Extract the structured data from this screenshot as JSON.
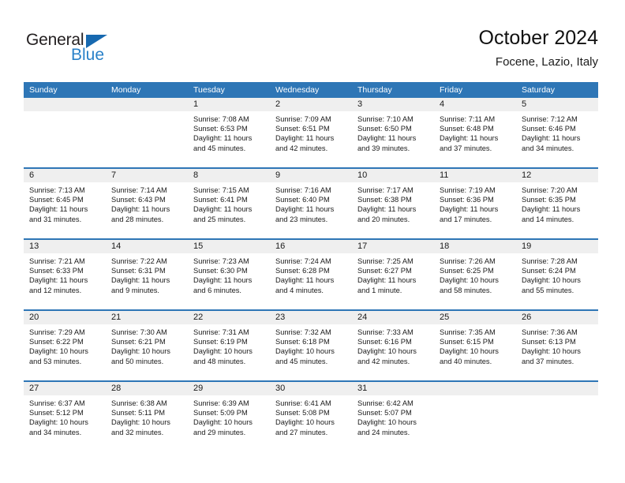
{
  "brand": {
    "name_top": "General",
    "name_bottom": "Blue",
    "color_dark": "#231f20",
    "color_blue": "#2a81c9",
    "triangle_color": "#1769b0"
  },
  "header": {
    "title": "October 2024",
    "subtitle": "Focene, Lazio, Italy"
  },
  "theme": {
    "header_bar": "#2e76b6",
    "day_band": "#efefef",
    "row_divider": "#2e76b6",
    "text": "#1a1a1a"
  },
  "weekdays": [
    "Sunday",
    "Monday",
    "Tuesday",
    "Wednesday",
    "Thursday",
    "Friday",
    "Saturday"
  ],
  "weeks": [
    [
      {
        "day": "",
        "sunrise": "",
        "sunset": "",
        "daylight1": "",
        "daylight2": "",
        "empty": true
      },
      {
        "day": "",
        "sunrise": "",
        "sunset": "",
        "daylight1": "",
        "daylight2": "",
        "empty": true
      },
      {
        "day": "1",
        "sunrise": "Sunrise: 7:08 AM",
        "sunset": "Sunset: 6:53 PM",
        "daylight1": "Daylight: 11 hours",
        "daylight2": "and 45 minutes."
      },
      {
        "day": "2",
        "sunrise": "Sunrise: 7:09 AM",
        "sunset": "Sunset: 6:51 PM",
        "daylight1": "Daylight: 11 hours",
        "daylight2": "and 42 minutes."
      },
      {
        "day": "3",
        "sunrise": "Sunrise: 7:10 AM",
        "sunset": "Sunset: 6:50 PM",
        "daylight1": "Daylight: 11 hours",
        "daylight2": "and 39 minutes."
      },
      {
        "day": "4",
        "sunrise": "Sunrise: 7:11 AM",
        "sunset": "Sunset: 6:48 PM",
        "daylight1": "Daylight: 11 hours",
        "daylight2": "and 37 minutes."
      },
      {
        "day": "5",
        "sunrise": "Sunrise: 7:12 AM",
        "sunset": "Sunset: 6:46 PM",
        "daylight1": "Daylight: 11 hours",
        "daylight2": "and 34 minutes."
      }
    ],
    [
      {
        "day": "6",
        "sunrise": "Sunrise: 7:13 AM",
        "sunset": "Sunset: 6:45 PM",
        "daylight1": "Daylight: 11 hours",
        "daylight2": "and 31 minutes."
      },
      {
        "day": "7",
        "sunrise": "Sunrise: 7:14 AM",
        "sunset": "Sunset: 6:43 PM",
        "daylight1": "Daylight: 11 hours",
        "daylight2": "and 28 minutes."
      },
      {
        "day": "8",
        "sunrise": "Sunrise: 7:15 AM",
        "sunset": "Sunset: 6:41 PM",
        "daylight1": "Daylight: 11 hours",
        "daylight2": "and 25 minutes."
      },
      {
        "day": "9",
        "sunrise": "Sunrise: 7:16 AM",
        "sunset": "Sunset: 6:40 PM",
        "daylight1": "Daylight: 11 hours",
        "daylight2": "and 23 minutes."
      },
      {
        "day": "10",
        "sunrise": "Sunrise: 7:17 AM",
        "sunset": "Sunset: 6:38 PM",
        "daylight1": "Daylight: 11 hours",
        "daylight2": "and 20 minutes."
      },
      {
        "day": "11",
        "sunrise": "Sunrise: 7:19 AM",
        "sunset": "Sunset: 6:36 PM",
        "daylight1": "Daylight: 11 hours",
        "daylight2": "and 17 minutes."
      },
      {
        "day": "12",
        "sunrise": "Sunrise: 7:20 AM",
        "sunset": "Sunset: 6:35 PM",
        "daylight1": "Daylight: 11 hours",
        "daylight2": "and 14 minutes."
      }
    ],
    [
      {
        "day": "13",
        "sunrise": "Sunrise: 7:21 AM",
        "sunset": "Sunset: 6:33 PM",
        "daylight1": "Daylight: 11 hours",
        "daylight2": "and 12 minutes."
      },
      {
        "day": "14",
        "sunrise": "Sunrise: 7:22 AM",
        "sunset": "Sunset: 6:31 PM",
        "daylight1": "Daylight: 11 hours",
        "daylight2": "and 9 minutes."
      },
      {
        "day": "15",
        "sunrise": "Sunrise: 7:23 AM",
        "sunset": "Sunset: 6:30 PM",
        "daylight1": "Daylight: 11 hours",
        "daylight2": "and 6 minutes."
      },
      {
        "day": "16",
        "sunrise": "Sunrise: 7:24 AM",
        "sunset": "Sunset: 6:28 PM",
        "daylight1": "Daylight: 11 hours",
        "daylight2": "and 4 minutes."
      },
      {
        "day": "17",
        "sunrise": "Sunrise: 7:25 AM",
        "sunset": "Sunset: 6:27 PM",
        "daylight1": "Daylight: 11 hours",
        "daylight2": "and 1 minute."
      },
      {
        "day": "18",
        "sunrise": "Sunrise: 7:26 AM",
        "sunset": "Sunset: 6:25 PM",
        "daylight1": "Daylight: 10 hours",
        "daylight2": "and 58 minutes."
      },
      {
        "day": "19",
        "sunrise": "Sunrise: 7:28 AM",
        "sunset": "Sunset: 6:24 PM",
        "daylight1": "Daylight: 10 hours",
        "daylight2": "and 55 minutes."
      }
    ],
    [
      {
        "day": "20",
        "sunrise": "Sunrise: 7:29 AM",
        "sunset": "Sunset: 6:22 PM",
        "daylight1": "Daylight: 10 hours",
        "daylight2": "and 53 minutes."
      },
      {
        "day": "21",
        "sunrise": "Sunrise: 7:30 AM",
        "sunset": "Sunset: 6:21 PM",
        "daylight1": "Daylight: 10 hours",
        "daylight2": "and 50 minutes."
      },
      {
        "day": "22",
        "sunrise": "Sunrise: 7:31 AM",
        "sunset": "Sunset: 6:19 PM",
        "daylight1": "Daylight: 10 hours",
        "daylight2": "and 48 minutes."
      },
      {
        "day": "23",
        "sunrise": "Sunrise: 7:32 AM",
        "sunset": "Sunset: 6:18 PM",
        "daylight1": "Daylight: 10 hours",
        "daylight2": "and 45 minutes."
      },
      {
        "day": "24",
        "sunrise": "Sunrise: 7:33 AM",
        "sunset": "Sunset: 6:16 PM",
        "daylight1": "Daylight: 10 hours",
        "daylight2": "and 42 minutes."
      },
      {
        "day": "25",
        "sunrise": "Sunrise: 7:35 AM",
        "sunset": "Sunset: 6:15 PM",
        "daylight1": "Daylight: 10 hours",
        "daylight2": "and 40 minutes."
      },
      {
        "day": "26",
        "sunrise": "Sunrise: 7:36 AM",
        "sunset": "Sunset: 6:13 PM",
        "daylight1": "Daylight: 10 hours",
        "daylight2": "and 37 minutes."
      }
    ],
    [
      {
        "day": "27",
        "sunrise": "Sunrise: 6:37 AM",
        "sunset": "Sunset: 5:12 PM",
        "daylight1": "Daylight: 10 hours",
        "daylight2": "and 34 minutes."
      },
      {
        "day": "28",
        "sunrise": "Sunrise: 6:38 AM",
        "sunset": "Sunset: 5:11 PM",
        "daylight1": "Daylight: 10 hours",
        "daylight2": "and 32 minutes."
      },
      {
        "day": "29",
        "sunrise": "Sunrise: 6:39 AM",
        "sunset": "Sunset: 5:09 PM",
        "daylight1": "Daylight: 10 hours",
        "daylight2": "and 29 minutes."
      },
      {
        "day": "30",
        "sunrise": "Sunrise: 6:41 AM",
        "sunset": "Sunset: 5:08 PM",
        "daylight1": "Daylight: 10 hours",
        "daylight2": "and 27 minutes."
      },
      {
        "day": "31",
        "sunrise": "Sunrise: 6:42 AM",
        "sunset": "Sunset: 5:07 PM",
        "daylight1": "Daylight: 10 hours",
        "daylight2": "and 24 minutes."
      },
      {
        "day": "",
        "sunrise": "",
        "sunset": "",
        "daylight1": "",
        "daylight2": "",
        "empty": true
      },
      {
        "day": "",
        "sunrise": "",
        "sunset": "",
        "daylight1": "",
        "daylight2": "",
        "empty": true
      }
    ]
  ]
}
